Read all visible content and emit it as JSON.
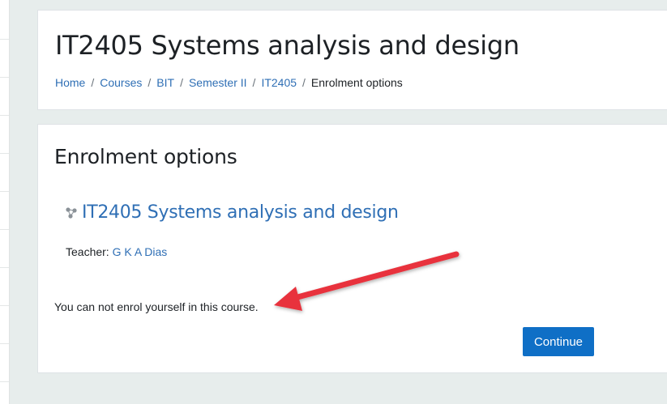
{
  "header": {
    "title": "IT2405 Systems analysis and design",
    "breadcrumb": {
      "items": [
        "Home",
        "Courses",
        "BIT",
        "Semester II",
        "IT2405"
      ],
      "separator": "/",
      "current": "Enrolment options"
    }
  },
  "main": {
    "section_title": "Enrolment options",
    "course": {
      "icon": "course-icon",
      "name": "IT2405 Systems analysis and design"
    },
    "teacher": {
      "label": "Teacher:",
      "name": "G K A Dias"
    },
    "message": "You can not enrol yourself in this course.",
    "continue_label": "Continue"
  },
  "annotation": {
    "type": "arrow",
    "color": "#e8333c",
    "points_to": "message"
  },
  "colors": {
    "page_background": "#e7edec",
    "link": "#2f6fb5",
    "primary_button": "#0f6fc6",
    "text": "#1d2125"
  }
}
